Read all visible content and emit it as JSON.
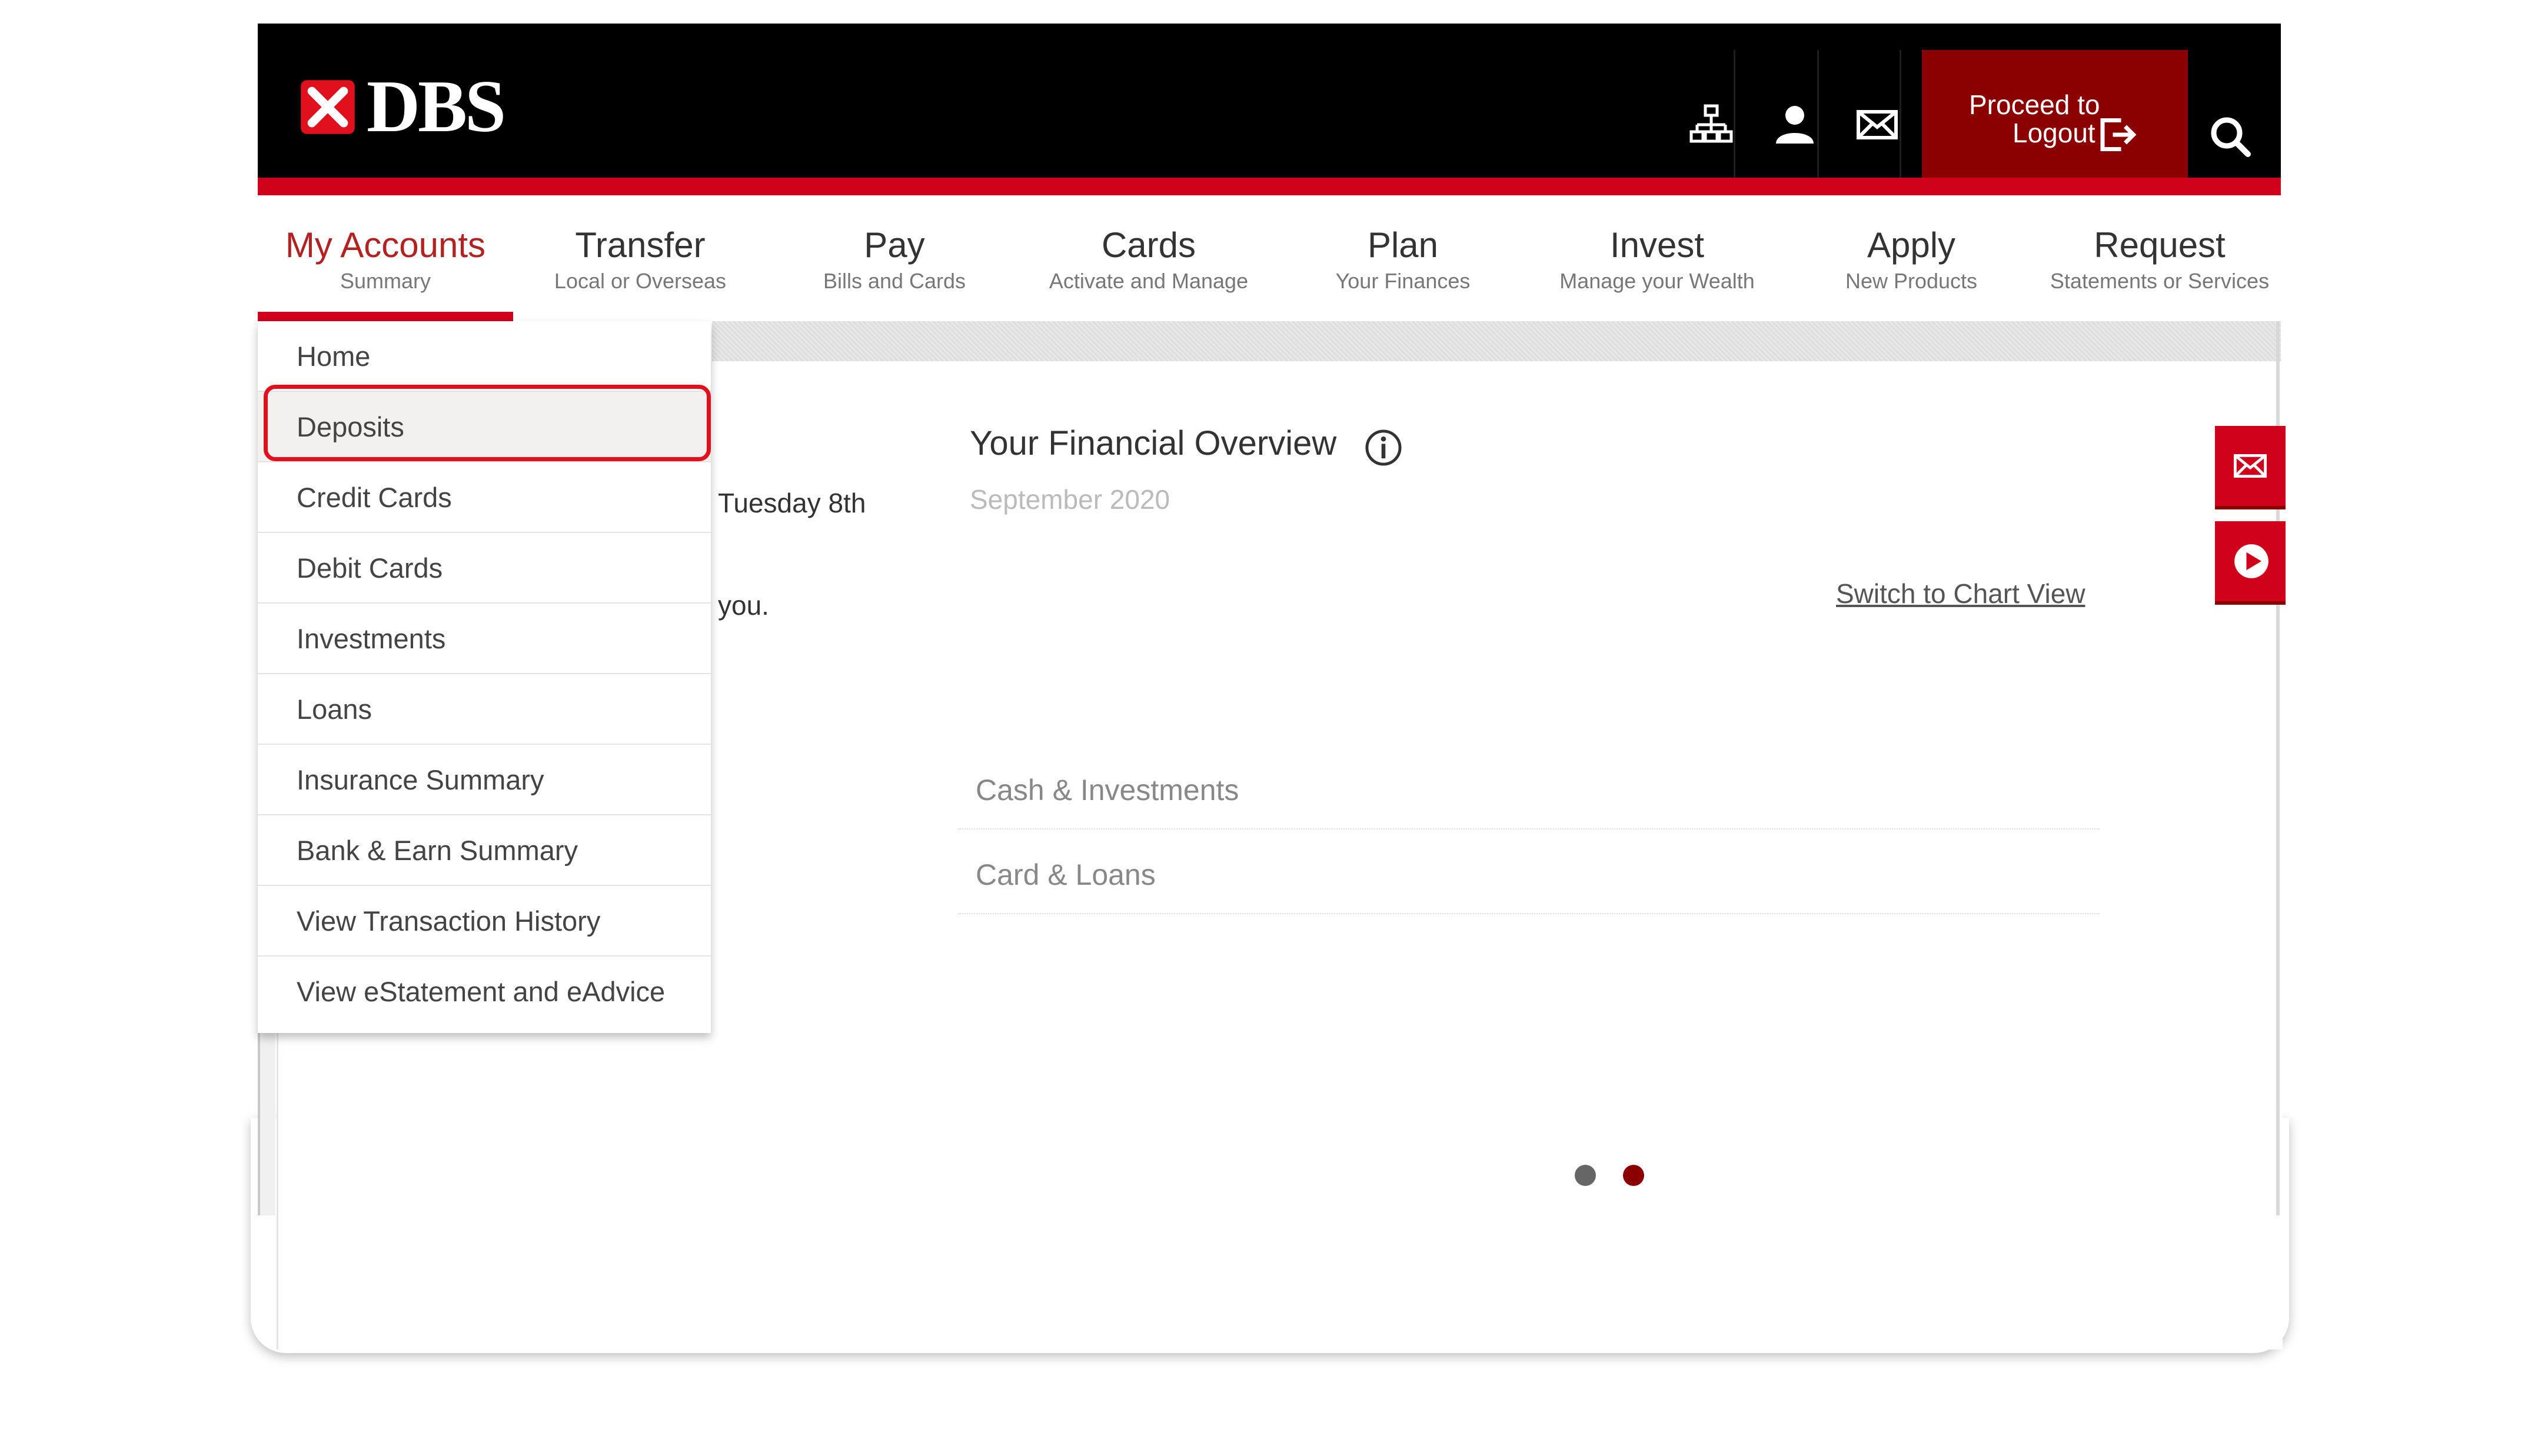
{
  "header": {
    "brand": "DBS",
    "logout_line1": "Proceed to",
    "logout_line2": "Logout",
    "icons": [
      "sitemap-icon",
      "user-icon",
      "mail-icon",
      "logout-icon",
      "search-icon"
    ],
    "colors": {
      "bar": "#000000",
      "accent": "#d0021b",
      "logout_bg": "#8b0000"
    }
  },
  "nav": {
    "items": [
      {
        "title": "My Accounts",
        "sub": "Summary"
      },
      {
        "title": "Transfer",
        "sub": "Local or Overseas"
      },
      {
        "title": "Pay",
        "sub": "Bills and Cards"
      },
      {
        "title": "Cards",
        "sub": "Activate and Manage"
      },
      {
        "title": "Plan",
        "sub": "Your Finances"
      },
      {
        "title": "Invest",
        "sub": "Manage your Wealth"
      },
      {
        "title": "Apply",
        "sub": "New Products"
      },
      {
        "title": "Request",
        "sub": "Statements or Services"
      }
    ],
    "active_index": 0
  },
  "dropdown": {
    "items": [
      "Home",
      "Deposits",
      "Credit Cards",
      "Debit Cards",
      "Investments",
      "Loans",
      "Insurance Summary",
      "Bank & Earn Summary",
      "View Transaction History",
      "View eStatement and eAdvice"
    ],
    "highlighted_index": 1
  },
  "background_text": {
    "partial_date": "Tuesday 8th",
    "partial_word": "you."
  },
  "overview": {
    "title": "Your Financial Overview",
    "date": "September 2020",
    "switch_link": "Switch to Chart View",
    "rows": [
      "Cash & Investments",
      "Card & Loans"
    ]
  },
  "carousel": {
    "dots": 2,
    "active_dot": 1,
    "colors": {
      "inactive": "#666666",
      "active": "#8b0000"
    }
  },
  "side_buttons": [
    "mail-icon",
    "play-icon"
  ]
}
